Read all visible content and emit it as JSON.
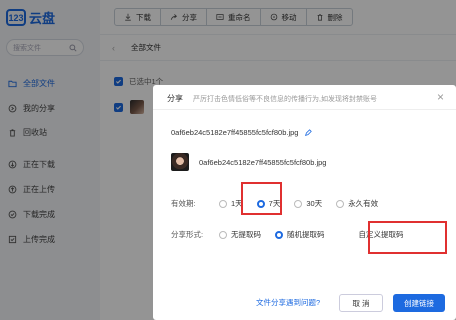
{
  "sidebar": {
    "logo_badge": "123",
    "logo_text": "云盘",
    "search_placeholder": "搜索文件",
    "items": [
      {
        "label": "全部文件",
        "icon": "folder-icon",
        "active": true
      },
      {
        "label": "我的分享",
        "icon": "share-icon",
        "active": false
      },
      {
        "label": "回收站",
        "icon": "trash-icon",
        "active": false
      },
      {
        "label": "正在下载",
        "icon": "download-icon",
        "active": false
      },
      {
        "label": "正在上传",
        "icon": "upload-icon",
        "active": false
      },
      {
        "label": "下载完成",
        "icon": "check-icon",
        "active": false
      },
      {
        "label": "上传完成",
        "icon": "check-icon",
        "active": false
      }
    ]
  },
  "toolbar": {
    "buttons": [
      {
        "label": "下载",
        "icon": "download-icon"
      },
      {
        "label": "分享",
        "icon": "share-icon"
      },
      {
        "label": "重命名",
        "icon": "rename-icon"
      },
      {
        "label": "移动",
        "icon": "move-icon"
      },
      {
        "label": "删除",
        "icon": "delete-icon"
      }
    ]
  },
  "main": {
    "breadcrumb": "全部文件",
    "selected_text": "已选中1个",
    "row_name": "0af6eb24c5182e7ff45855fc5fcf80b.jpg"
  },
  "modal": {
    "title": "分享",
    "subtitle": "严厉打击色情低俗等不良信息的传播行为,如发现将封禁账号",
    "file_name": "0af6eb24c5182e7ff45855fc5fcf80b.jpg",
    "preview_name": "0af6eb24c5182e7ff45855fc5fcf80b.jpg",
    "validity_label": "有效期:",
    "validity_options": [
      "1天",
      "7天",
      "30天",
      "永久有效"
    ],
    "validity_selected": "7天",
    "form_label": "分享形式:",
    "form_options": [
      "无提取码",
      "随机提取码",
      "自定义提取码"
    ],
    "form_selected": "随机提取码",
    "help_link": "文件分享遇到问题?",
    "cancel_label": "取 消",
    "create_label": "创建链接"
  },
  "colors": {
    "accent": "#1d6ae0",
    "highlight": "#e03030"
  }
}
